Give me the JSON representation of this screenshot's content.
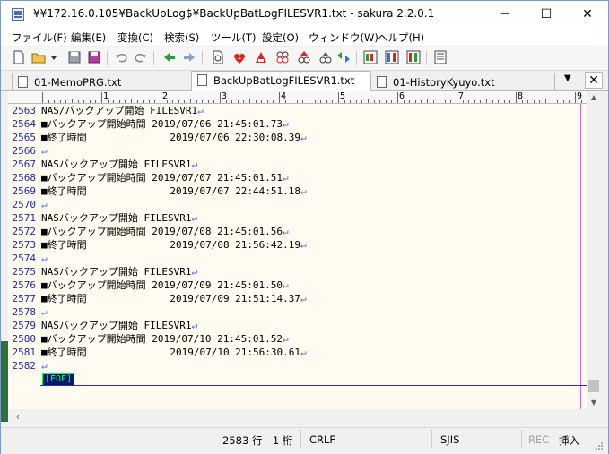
{
  "window": {
    "title": "¥¥172.16.0.105¥BackUpLog$¥BackUpBatLogFILESVR1.txt - sakura 2.2.0.1",
    "minimize": "─",
    "maximize": "☐",
    "close": "✕"
  },
  "menu": [
    "ファイル(F)",
    "編集(E)",
    "変換(C)",
    "検索(S)",
    "ツール(T)",
    "設定(O)",
    "ウィンドウ(W)",
    "ヘルプ(H)"
  ],
  "toolbar": {
    "icons": [
      "new-file-icon",
      "open-file-icon",
      "dropdown-icon",
      "save-icon",
      "save-all-icon",
      "undo-icon",
      "redo-icon",
      "prev-jump-icon",
      "next-jump-icon",
      "search-prev-icon",
      "search-next-icon",
      "search-mark-icon",
      "grep-icon",
      "grep-replace-icon",
      "tag-jump-icon",
      "compare-icon",
      "outline-icon",
      "macro-icon",
      "settings-icon"
    ]
  },
  "tabs": [
    {
      "label": "01-MemoPRG.txt",
      "active": false
    },
    {
      "label": "BackUpBatLogFILESVR1.txt",
      "active": true
    },
    {
      "label": "01-HistoryKyuyo.txt",
      "active": false
    }
  ],
  "tab_menu_glyph": "▼",
  "tab_close_glyph": "✕",
  "ruler": {
    "numbers": [
      "1",
      "2",
      "3",
      "4",
      "5",
      "6",
      "7",
      "8",
      "9"
    ]
  },
  "editor": {
    "lines": [
      {
        "no": "2563",
        "text": "NAS/バックアップ開始 FILESVR1"
      },
      {
        "no": "2564",
        "text": "■バックアップ開始時間 2019/07/06 21:45:01.73"
      },
      {
        "no": "2565",
        "text": "■終了時間              2019/07/06 22:30:08.39"
      },
      {
        "no": "2566",
        "text": ""
      },
      {
        "no": "2567",
        "text": "NASバックアップ開始 FILESVR1"
      },
      {
        "no": "2568",
        "text": "■バックアップ開始時間 2019/07/07 21:45:01.51"
      },
      {
        "no": "2569",
        "text": "■終了時間              2019/07/07 22:44:51.18"
      },
      {
        "no": "2570",
        "text": ""
      },
      {
        "no": "2571",
        "text": "NASバックアップ開始 FILESVR1"
      },
      {
        "no": "2572",
        "text": "■バックアップ開始時間 2019/07/08 21:45:01.56"
      },
      {
        "no": "2573",
        "text": "■終了時間              2019/07/08 21:56:42.19"
      },
      {
        "no": "2574",
        "text": ""
      },
      {
        "no": "2575",
        "text": "NASバックアップ開始 FILESVR1"
      },
      {
        "no": "2576",
        "text": "■バックアップ開始時間 2019/07/09 21:45:01.50"
      },
      {
        "no": "2577",
        "text": "■終了時間              2019/07/09 21:51:14.37"
      },
      {
        "no": "2578",
        "text": ""
      },
      {
        "no": "2579",
        "text": "NASバックアップ開始 FILESVR1"
      },
      {
        "no": "2580",
        "text": "■バックアップ開始時間 2019/07/10 21:45:01.52"
      },
      {
        "no": "2581",
        "text": "■終了時間              2019/07/10 21:56:30.61"
      },
      {
        "no": "2582",
        "text": ""
      }
    ],
    "return_glyph": "↵",
    "eof_marker": "[EOF]"
  },
  "status": {
    "position": "2583 行　1 桁",
    "line_ending": "CRLF",
    "encoding": "SJIS",
    "rec": "REC",
    "insert_mode": "挿入"
  },
  "colors": {
    "editor_bg": "#fffbf0",
    "line_number": "#1f2aa8",
    "return_mark": "#4a6fe0",
    "eof_fg": "#00ff66",
    "eof_bg": "#001a66"
  }
}
